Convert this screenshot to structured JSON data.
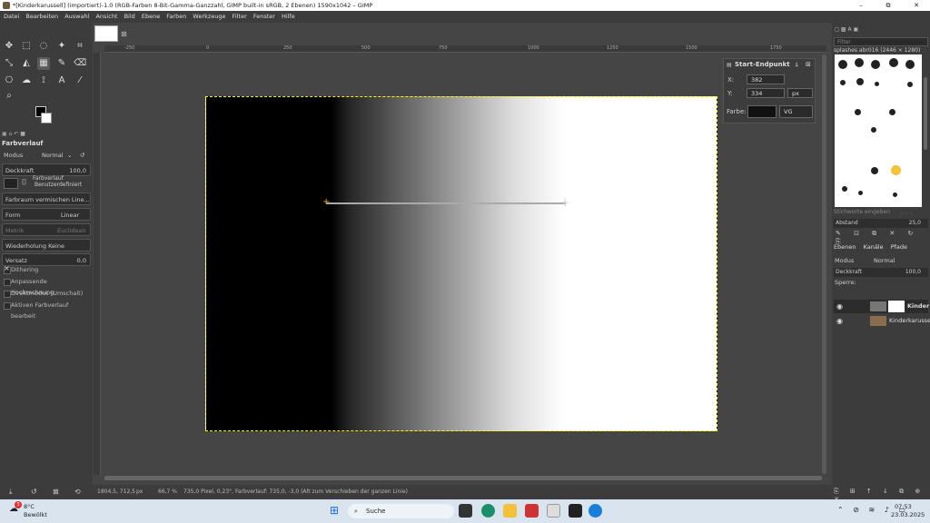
{
  "window": {
    "title": "*[Kinderkarussell] (importiert)-1.0 (RGB-Farben 8-Bit-Gamma-Ganzzahl, GIMP built-in sRGB, 2 Ebenen) 1590x1042 – GIMP",
    "controls": [
      "–",
      "⧉",
      "✕"
    ]
  },
  "menu": [
    "Datei",
    "Bearbeiten",
    "Auswahl",
    "Ansicht",
    "Bild",
    "Ebene",
    "Farben",
    "Werkzeuge",
    "Filter",
    "Fenster",
    "Hilfe"
  ],
  "tool_options": {
    "title": "Farbverlauf",
    "mode_label": "Modus",
    "mode_value": "Normal",
    "opacity_label": "Deckkraft",
    "opacity_value": "100,0",
    "gradient_label": "Farbverlauf",
    "gradient_value": "Benutzerdefiniert",
    "blend_space": "Farbraum vermischen Line...",
    "shape_label": "Form",
    "shape_value": "Linear",
    "metric_label": "Metrik",
    "metric_value": "Euclidean",
    "repeat": "Wiederholung Keine (erwei...",
    "offset_label": "Versatz",
    "offset_value": "0,0",
    "dithering": "Dithering",
    "adaptive": "Anpassende Hochrechnung",
    "instant": "Direktmodus (Umschalt)",
    "modify_active": "Aktiven Farbverlauf bearbeit"
  },
  "ruler": {
    "h_ticks": [
      "-250",
      "0",
      "250",
      "500",
      "750",
      "1000",
      "1250",
      "1500",
      "1750"
    ]
  },
  "start_endpoint": {
    "title": "Start-Endpunkt",
    "x_label": "X:",
    "x_value": "382",
    "y_label": "Y:",
    "y_value": "334",
    "unit": "px",
    "color_label": "Farbe:",
    "color_value": "VG"
  },
  "status": {
    "coords": "1804,5, 712,5",
    "unit": "px",
    "zoom": "66,7 %",
    "message": "735,0 Pixel, 0,23°, Farbverlauf: 735,0, -3,0 (Alt zum Verschieben der ganzen Linie)"
  },
  "brushes": {
    "filter_placeholder": "Filter",
    "name": "splashes abr016 (2446 × 1280)",
    "tags_placeholder": "Stichworte eingeben",
    "spacing_label": "Abstand",
    "spacing_value": "25,0"
  },
  "layers": {
    "tabs": [
      "Ebenen",
      "Kanäle",
      "Pfade"
    ],
    "mode_label": "Modus",
    "mode_value": "Normal",
    "opacity_label": "Deckkraft",
    "opacity_value": "100,0",
    "lock_label": "Sperre:",
    "items": [
      {
        "name": "Kinder"
      },
      {
        "name": "Kinderkarussell"
      }
    ]
  },
  "taskbar": {
    "weather_temp": "8°C",
    "weather_desc": "Bewölkt",
    "weather_badge": "3",
    "search": "Suche",
    "time": "07:53",
    "date": "23.03.2025"
  },
  "colors": {
    "fg": "#000000",
    "bg": "#ffffff",
    "accent_orange": "#e8a020",
    "selection": "#ffff00"
  }
}
